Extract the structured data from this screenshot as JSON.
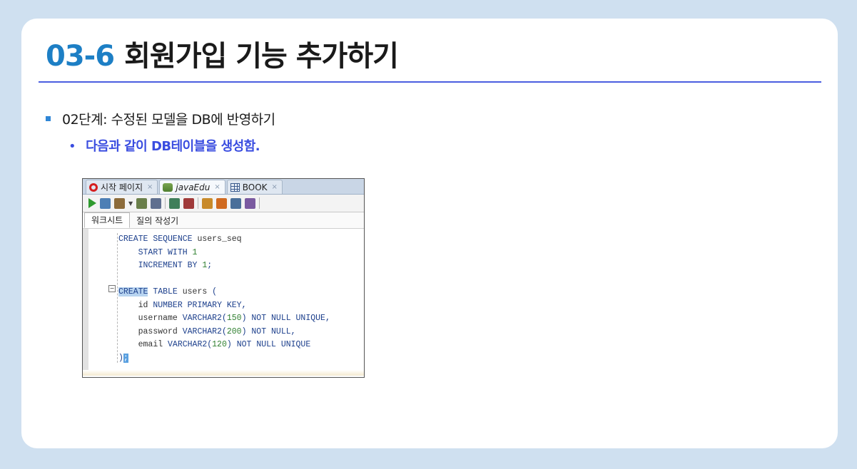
{
  "slide": {
    "title_number": "03-6",
    "title_text": "회원가입 기능 추가하기",
    "bullet1": "02단계: 수정된 모델을 DB에 반영하기",
    "bullet2": "다음과 같이 DB테이블을 생성함.",
    "bullet2_marker": "•"
  },
  "ide": {
    "tabs": [
      {
        "label": "시작 페이지",
        "icon": "oracle-icon",
        "close": "×"
      },
      {
        "label": "javaEdu",
        "icon": "db-connection-icon",
        "close": "×"
      },
      {
        "label": "BOOK",
        "icon": "table-grid-icon",
        "close": "×"
      }
    ],
    "subtabs": [
      "워크시트",
      "질의 작성기"
    ],
    "code_lines": [
      "CREATE SEQUENCE users_seq",
      "    START WITH 1",
      "    INCREMENT BY 1;",
      "",
      "CREATE TABLE users (",
      "    id NUMBER PRIMARY KEY,",
      "    username VARCHAR2(150) NOT NULL UNIQUE,",
      "    password VARCHAR2(200) NOT NULL,",
      "    email VARCHAR2(120) NOT NULL UNIQUE",
      ");"
    ],
    "toolbar_icons": [
      "run-statement-icon",
      "run-script-icon",
      "autotrace-icon",
      "explain-plan-icon",
      "sql-tuning-icon",
      "commit-icon",
      "rollback-icon",
      "sql-history-icon",
      "clear-icon",
      "sql-monitor-icon",
      "format-icon"
    ]
  },
  "colors": {
    "accent_blue": "#1d7fc5",
    "rule_blue": "#4a5ee0",
    "bullet2_blue": "#3a4de0",
    "background": "#cfe0f0"
  }
}
